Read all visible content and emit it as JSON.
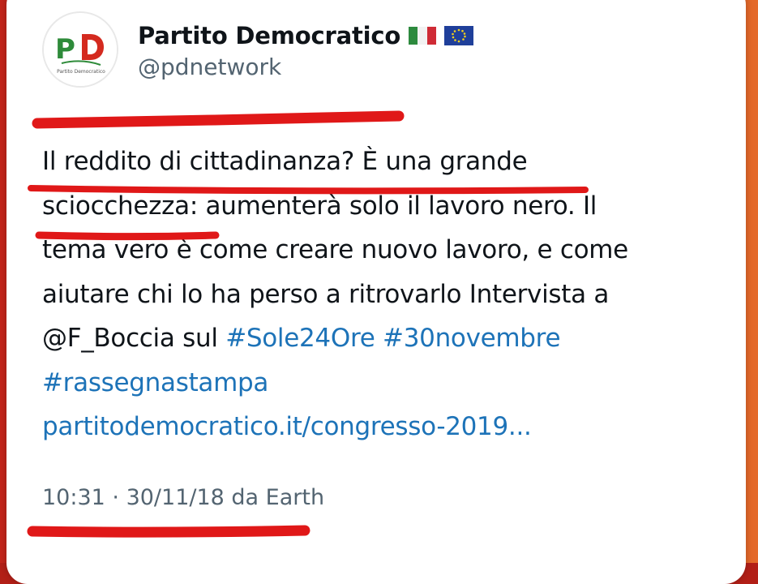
{
  "account": {
    "display_name": "Partito Democratico",
    "handle": "@pdnetwork",
    "avatar_logo_text": "PD",
    "avatar_caption": "Partito Democratico",
    "flags": [
      "italy-flag-icon",
      "eu-flag-icon"
    ]
  },
  "tweet": {
    "line1": "Il reddito di cittadinanza? È una grande",
    "line2_a": "sciocchezza:",
    "line2_b": " aumenterà solo il lavoro nero. Il",
    "line3": "tema vero è come creare nuovo lavoro, e come",
    "line4": "aiutare chi lo ha perso a ritrovarlo Intervista a",
    "line5_mention": "@F_Boccia",
    "line5_sul": " sul ",
    "hashtag_sole": "#Sole24Ore",
    "hashtag_date": "#30novembre",
    "hashtag_rassegna": "#rassegnastampa",
    "link": "partitodemocratico.it/congresso-2019..."
  },
  "meta": {
    "time": "10:31",
    "separator": " · ",
    "date": "30/11/18",
    "source": " da Earth"
  },
  "colors": {
    "link": "#1d73b8",
    "marker": "#e01818",
    "background": "#b21f17"
  }
}
